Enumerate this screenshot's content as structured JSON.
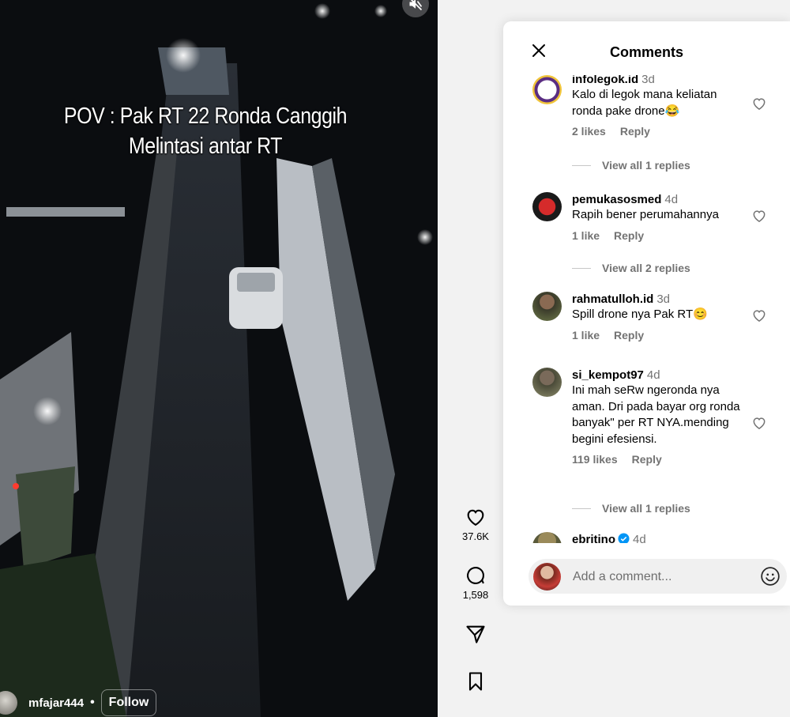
{
  "video": {
    "caption_line1": "POV : Pak RT 22 Ronda Canggih",
    "caption_line2": "Melintasi antar RT",
    "author": "mfajar444",
    "separator": "•",
    "follow_label": "Follow"
  },
  "actions": {
    "like_count": "37.6K",
    "comment_count": "1,598"
  },
  "panel": {
    "title": "Comments",
    "input_placeholder": "Add a comment..."
  },
  "comments": [
    {
      "user": "infolegok.id",
      "time": "3d",
      "text": "Kalo di legok mana keliatan ronda pake drone😂",
      "likes": "2 likes",
      "reply": "Reply",
      "view_replies": "View all 1 replies"
    },
    {
      "user": "pemukasosmed",
      "time": "4d",
      "text": "Rapih bener perumahannya",
      "likes": "1 like",
      "reply": "Reply",
      "view_replies": "View all 2 replies"
    },
    {
      "user": "rahmatulloh.id",
      "time": "3d",
      "text": "Spill drone nya Pak RT😊",
      "likes": "1 like",
      "reply": "Reply"
    },
    {
      "user": "si_kempot97",
      "time": "4d",
      "text": "Ini mah seRw ngeronda nya aman. Dri pada bayar org ronda banyak\" per RT NYA.mending begini efesiensi.",
      "likes": "119 likes",
      "reply": "Reply",
      "view_replies": "View all 1 replies"
    },
    {
      "user": "ebritino",
      "time": "4d",
      "verified": true
    }
  ],
  "colors": {
    "panel_bg": "#ffffff",
    "page_bg": "#f2f2f2",
    "muted_text": "#737373",
    "verified_blue": "#0095f6",
    "video_bg": "#0a0c0e"
  },
  "icons": [
    "mute-icon",
    "heart-icon",
    "comment-icon",
    "share-icon",
    "bookmark-icon",
    "close-icon",
    "emoji-icon",
    "verified-icon"
  ]
}
